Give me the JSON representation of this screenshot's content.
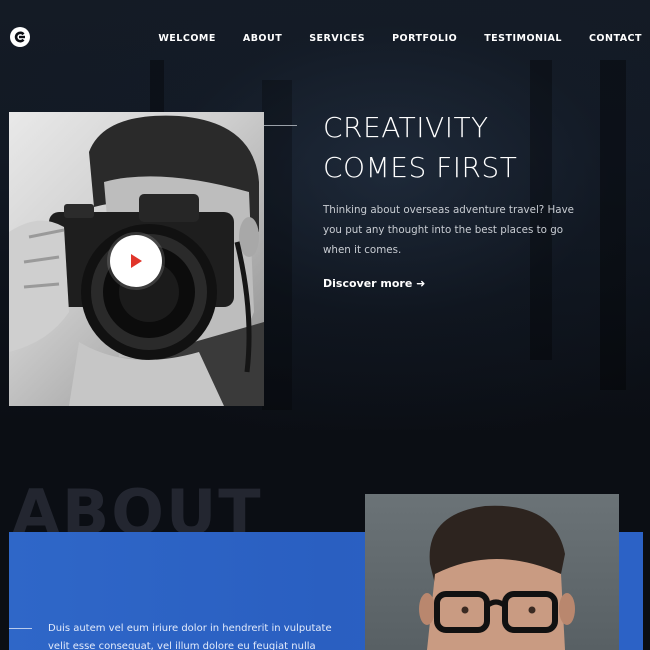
{
  "nav": {
    "items": [
      "WELCOME",
      "ABOUT",
      "SERVICES",
      "PORTFOLIO",
      "TESTIMONIAL",
      "CONTACT"
    ]
  },
  "hero": {
    "title_line1": "CREATIVITY",
    "title_line2": "COMES FIRST",
    "description": "Thinking about overseas adventure travel? Have you put any thought into the best places to go when it comes.",
    "cta": "Discover more ➜"
  },
  "about": {
    "heading": "ABOUT",
    "text_line1": "Duis autem vel eum iriure dolor in hendrerit in vulputate",
    "text_line2": "velit esse consequat, vel illum dolore eu feugiat nulla"
  },
  "colors": {
    "accent_blue": "#2f67c8",
    "background": "#0b0e14",
    "play_icon": "#e0352b"
  },
  "icons": {
    "logo": "c-logo-icon",
    "play": "play-icon"
  }
}
